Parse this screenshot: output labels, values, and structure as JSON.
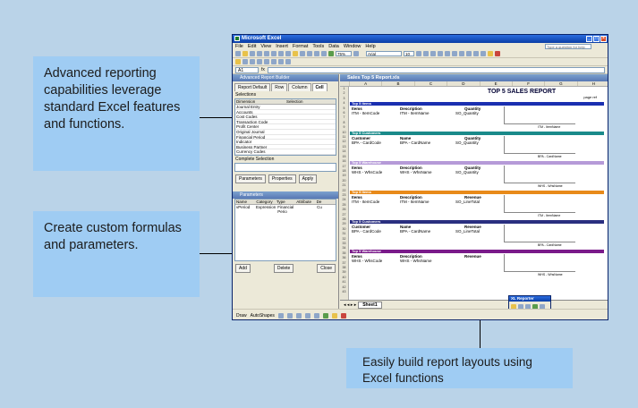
{
  "callouts": {
    "advanced": "Advanced reporting capabilities leverage standard Excel features and functions.",
    "formulas": "Create custom formulas and parameters.",
    "layouts": "Easily build report layouts using Excel functions"
  },
  "excel": {
    "title": "Microsoft Excel",
    "menu": [
      "File",
      "Edit",
      "View",
      "Insert",
      "Format",
      "Tools",
      "Data",
      "Window",
      "Help"
    ],
    "help_placeholder": "Type a question for help",
    "zoom": "75%",
    "font": "Arial",
    "font_size": "10",
    "cell_ref": "A1",
    "fx": "fx"
  },
  "builder": {
    "title": "Advanced Report Builder",
    "tabs": [
      "Report Default",
      "Row",
      "Column",
      "Cell"
    ],
    "selections_label": "Selections",
    "grid_headers": [
      "Dimension",
      "Selection"
    ],
    "dimensions": [
      "Journal Entry",
      "Accounts",
      "Cost Codes",
      "Transaction Code",
      "Profit Center",
      "Original Journal",
      "Financial Period",
      "Indicator",
      "Business Partner",
      "Currency Codes"
    ],
    "complete_selection": "Complete Selection",
    "parameters_btn": "Parameters",
    "properties_btn": "Properties",
    "apply_btn": "Apply"
  },
  "parameters": {
    "title": "Parameters",
    "headers": [
      "Name",
      "Category",
      "Type",
      "Attribute",
      "De"
    ],
    "row": [
      "vPeriod",
      "Expression",
      "Financial Perio",
      "",
      "Cu"
    ],
    "add_btn": "Add",
    "delete_btn": "Delete",
    "close_btn": "Close"
  },
  "sheet": {
    "file_title": "Sales Top 5 Report.xls",
    "columns": [
      "A",
      "B",
      "C",
      "D",
      "E",
      "F",
      "G",
      "H"
    ],
    "report_title": "TOP 5 SALES REPORT",
    "page_ref": "page ref",
    "sections": [
      {
        "band": "Top 5 Items",
        "color": "#1a2fb0",
        "h1": "Items",
        "h2": "Description",
        "h3": "Quantity",
        "v1": "ITM - ItemCode",
        "v2": "ITM - ItemName",
        "v3": "SO_Quantity",
        "legend": "ITM - ItemName"
      },
      {
        "band": "Top 5 Customers",
        "color": "#1a8a8a",
        "h1": "Customer",
        "h2": "Name",
        "h3": "Quantity",
        "v1": "BPA - CardCode",
        "v2": "BPA - CardName",
        "v3": "SO_Quantity",
        "legend": "BPA - CardName"
      },
      {
        "band": "Top 5 Warehouse",
        "color": "#b59ad8",
        "h1": "Items",
        "h2": "Description",
        "h3": "Quantity",
        "v1": "WHS - WhsCode",
        "v2": "WHS - WhsName",
        "v3": "SO_Quantity",
        "legend": "WHS - WhsName"
      },
      {
        "band": "Top 5 Items",
        "color": "#e88a1a",
        "h1": "Items",
        "h2": "Description",
        "h3": "Revenue",
        "v1": "ITM - ItemCode",
        "v2": "ITM - ItemName",
        "v3": "SO_LineTotal",
        "legend": "ITM - ItemName"
      },
      {
        "band": "Top 5 Customers",
        "color": "#2a2f80",
        "h1": "Customer",
        "h2": "Name",
        "h3": "Revenue",
        "v1": "BPA - CardCode",
        "v2": "BPA - CardName",
        "v3": "SO_LineTotal",
        "legend": "BPA - CardName"
      },
      {
        "band": "Top 5 Warehouse",
        "color": "#7a1a8a",
        "h1": "Items",
        "h2": "Description",
        "h3": "Revenue",
        "v1": "WHS - WhsCode",
        "v2": "WHS - WhsName",
        "v3": "",
        "legend": "WHS - WhsName"
      }
    ],
    "tab": "Sheet1",
    "reporter": "XL Reporter"
  },
  "drawbar": {
    "draw": "Draw",
    "autoshapes": "AutoShapes"
  }
}
